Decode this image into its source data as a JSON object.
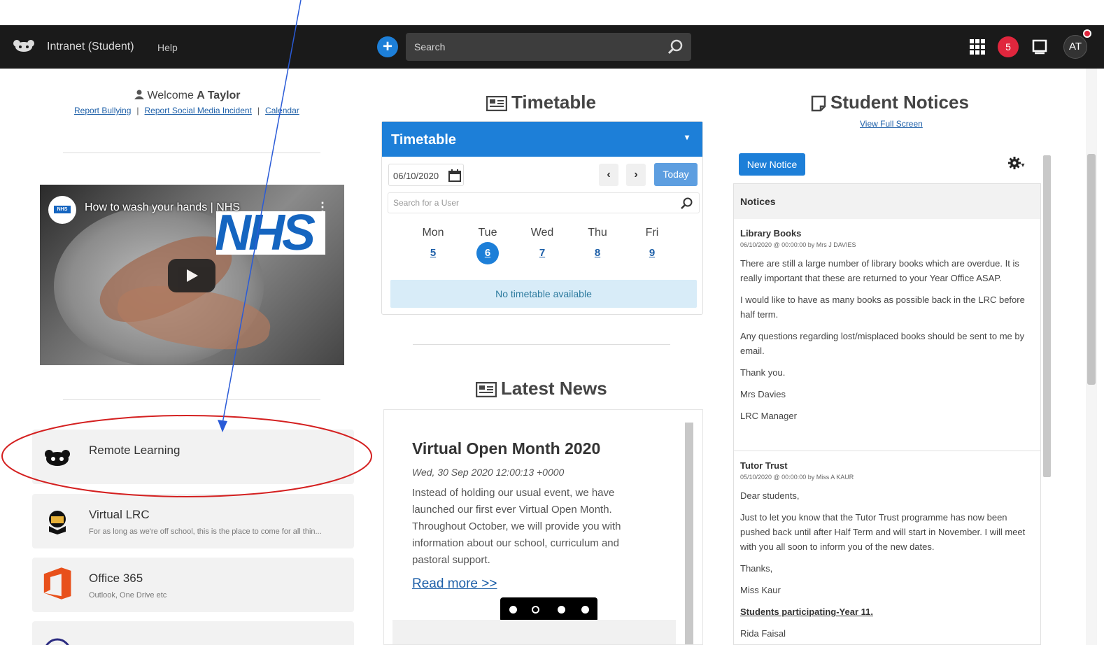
{
  "topbar": {
    "app_title": "Intranet (Student)",
    "help_label": "Help",
    "search_placeholder": "Search",
    "notification_count": "5",
    "avatar_initials": "AT"
  },
  "welcome": {
    "prefix": "Welcome",
    "name": "A Taylor",
    "links": [
      "Report Bullying",
      "Report Social Media Incident",
      "Calendar"
    ]
  },
  "video": {
    "title": "How to wash your hands | NHS",
    "logo_text": "NHS",
    "channel_badge": "NHS"
  },
  "link_cards": [
    {
      "title": "Remote Learning",
      "subtitle": ""
    },
    {
      "title": "Virtual LRC",
      "subtitle": "For as long as we're off school, this is the place to come for all thin..."
    },
    {
      "title": "Office 365",
      "subtitle": "Outlook, One Drive etc"
    }
  ],
  "timetable": {
    "section_title": "Timetable",
    "panel_title": "Timetable",
    "date_value": "06/10/2020",
    "today_label": "Today",
    "user_search_placeholder": "Search for a User",
    "days": [
      {
        "name": "Mon",
        "date": "5"
      },
      {
        "name": "Tue",
        "date": "6"
      },
      {
        "name": "Wed",
        "date": "7"
      },
      {
        "name": "Thu",
        "date": "8"
      },
      {
        "name": "Fri",
        "date": "9"
      }
    ],
    "empty_message": "No timetable available"
  },
  "news": {
    "section_title": "Latest News",
    "title": "Virtual Open Month 2020",
    "date": "Wed, 30 Sep 2020 12:00:13 +0000",
    "body": "Instead of holding our usual event, we have launched our first ever Virtual Open Month. Throughout October, we will provide you with information about our school, curriculum and pastoral support.",
    "read_more": "Read more >>"
  },
  "notices": {
    "section_title": "Student Notices",
    "view_full": "View Full Screen",
    "new_notice_label": "New Notice",
    "list_header": "Notices",
    "items": [
      {
        "title": "Library Books",
        "meta": "06/10/2020 @ 00:00:00 by Mrs J DAVIES",
        "paragraphs": [
          "There are still a large number of library books which are overdue.  It is really important that these are returned to your Year Office ASAP.",
          "I would like to have as many books as possible back in the LRC before half term.",
          "Any questions regarding lost/misplaced books should be sent to me by email.",
          "Thank you.",
          "Mrs Davies",
          "LRC Manager"
        ]
      },
      {
        "title": "Tutor Trust",
        "meta": "05/10/2020 @ 00:00:00 by Miss A KAUR",
        "paragraphs": [
          "Dear students,",
          "Just to let you know that the Tutor Trust programme has now been pushed back until after Half Term and will start in November. I will meet with you all soon to inform you of the new dates.",
          "Thanks,",
          "Miss Kaur"
        ],
        "highlight": "Students participating-Year 11.",
        "last_line": "Rida Faisal"
      }
    ]
  },
  "colors": {
    "topbar": "#1a1a1a",
    "accent": "#1d7fd8",
    "badge": "#e0263d",
    "annotation": "#d42020",
    "arrow": "#2a5bd7"
  }
}
